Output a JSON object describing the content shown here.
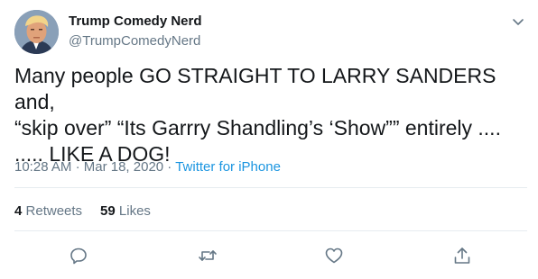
{
  "user": {
    "name": "Trump Comedy Nerd",
    "handle": "@TrumpComedyNerd"
  },
  "tweet": {
    "text": "Many people GO STRAIGHT TO LARRY SANDERS and,\n“skip over”  “Its Garrry Shandling’s ‘Show”” entirely ....\n.....   LIKE A DOG!",
    "time": "10:28 AM",
    "separator": "·",
    "date": "Mar 18, 2020",
    "source": "Twitter for iPhone"
  },
  "stats": {
    "retweets_count": "4",
    "retweets_label": "Retweets",
    "likes_count": "59",
    "likes_label": "Likes"
  },
  "icons": {
    "menu": "chevron-down-icon",
    "reply": "reply-icon",
    "retweet": "retweet-icon",
    "like": "heart-icon",
    "share": "share-icon"
  },
  "colors": {
    "text": "#14171a",
    "secondary": "#657786",
    "link": "#1b95e0",
    "divider": "#e6ecf0"
  }
}
